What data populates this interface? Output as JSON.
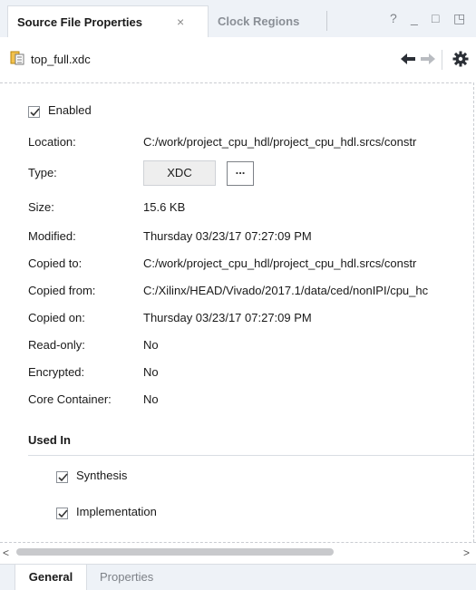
{
  "tabs": {
    "active_label": "Source File Properties",
    "close_glyph": "×",
    "inactive_label": "Clock Regions"
  },
  "window_controls": {
    "help": "?",
    "minimize": "_",
    "maximize": "□",
    "float": "◳"
  },
  "toolbar": {
    "file_name": "top_full.xdc",
    "file_icon": "xdc-file-icon",
    "back_icon": "arrow-left-icon",
    "forward_icon": "arrow-right-icon",
    "settings_icon": "gear-icon"
  },
  "general": {
    "enabled_label": "Enabled",
    "enabled_checked": true,
    "location_label": "Location:",
    "location_value": "C:/work/project_cpu_hdl/project_cpu_hdl.srcs/constr",
    "type_label": "Type:",
    "type_value": "XDC",
    "type_button": "...",
    "size_label": "Size:",
    "size_value": "15.6 KB",
    "modified_label": "Modified:",
    "modified_value": "Thursday 03/23/17 07:27:09 PM",
    "copied_to_label": "Copied to:",
    "copied_to_value": "C:/work/project_cpu_hdl/project_cpu_hdl.srcs/constr",
    "copied_from_label": "Copied from:",
    "copied_from_value": "C:/Xilinx/HEAD/Vivado/2017.1/data/ced/nonIPI/cpu_hc",
    "copied_on_label": "Copied on:",
    "copied_on_value": "Thursday 03/23/17 07:27:09 PM",
    "read_only_label": "Read-only:",
    "read_only_value": "No",
    "encrypted_label": "Encrypted:",
    "encrypted_value": "No",
    "core_container_label": "Core Container:",
    "core_container_value": "No"
  },
  "used_in": {
    "title": "Used In",
    "synthesis_label": "Synthesis",
    "synthesis_checked": true,
    "implementation_label": "Implementation",
    "implementation_checked": true
  },
  "scroll": {
    "left_glyph": "<",
    "right_glyph": ">"
  },
  "bottom_tabs": {
    "general": "General",
    "properties": "Properties"
  },
  "colors": {
    "tab_bar": "#eef2f7",
    "accent_orange": "#e8a100",
    "icon_dark": "#2b2f36"
  }
}
